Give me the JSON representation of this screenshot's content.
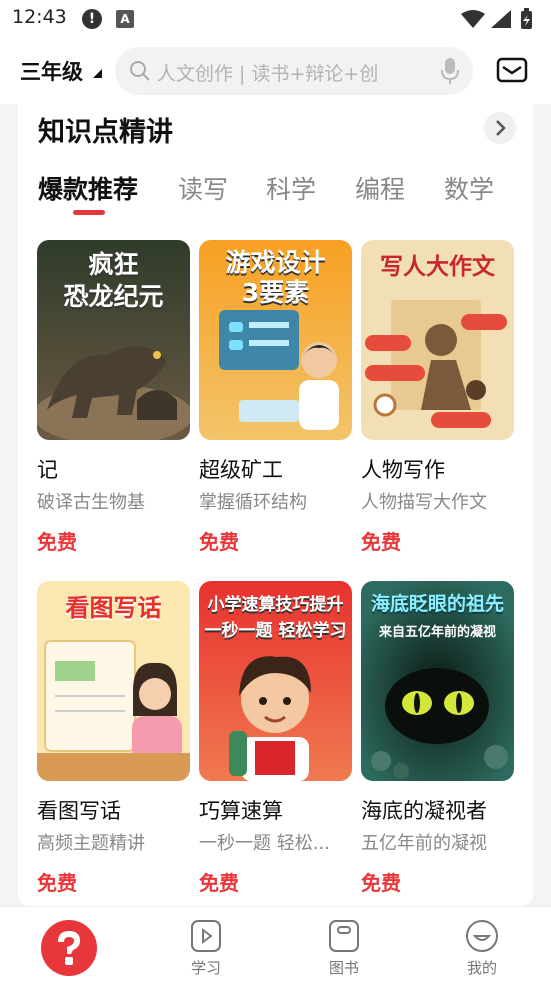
{
  "status_bar": {
    "time": "12:43",
    "alert_glyph": "!",
    "app_glyph": "A"
  },
  "header": {
    "grade": "三年级",
    "search_placeholder": "人文创作 | 读书+辩论+创",
    "icons": [
      "search-icon",
      "mic-icon",
      "mail-icon"
    ]
  },
  "section": {
    "title": "知识点精讲",
    "tabs": [
      "爆款推荐",
      "读写",
      "科学",
      "编程",
      "数学"
    ],
    "active_tab": 0
  },
  "items": [
    {
      "cover": [
        "疯狂",
        "恐龙纪元"
      ],
      "title": "记",
      "subtitle": "破译古生物基",
      "price": "免费"
    },
    {
      "cover": [
        "游戏设计",
        "3要素"
      ],
      "title": "超级矿工",
      "subtitle": "掌握循环结构",
      "price": "免费"
    },
    {
      "cover": [
        "写人大作文"
      ],
      "title": "人物写作",
      "subtitle": "人物描写大作文",
      "price": "免费"
    },
    {
      "cover": [
        "看图写话"
      ],
      "title": "看图写话",
      "subtitle": "高频主题精讲",
      "price": "免费"
    },
    {
      "cover": [
        "小学速算技巧提升",
        "一秒一题 轻松学习"
      ],
      "title": "巧算速算",
      "subtitle": "一秒一题 轻松...",
      "price": "免费"
    },
    {
      "cover": [
        "海底眨眼的祖先",
        "来自五亿年前的凝视"
      ],
      "title": "海底的凝视者",
      "subtitle": "五亿年前的凝视",
      "price": "免费"
    }
  ],
  "bottom_nav": [
    {
      "label": "",
      "icon": "home-logo-icon"
    },
    {
      "label": "学习",
      "icon": "play-icon"
    },
    {
      "label": "图书",
      "icon": "book-icon"
    },
    {
      "label": "我的",
      "icon": "smile-icon"
    }
  ],
  "colors": {
    "accent": "#e8373a",
    "background": "#f4f4f4",
    "card": "#ffffff"
  }
}
